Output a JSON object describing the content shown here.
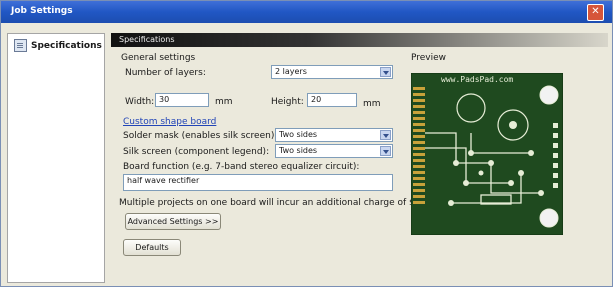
{
  "window": {
    "title": "Job Settings"
  },
  "nav": {
    "items": [
      {
        "label": "Specifications",
        "icon": "document-icon"
      }
    ]
  },
  "panel": {
    "header": "Specifications",
    "general_label": "General settings",
    "preview_label": "Preview",
    "layers_label": "Number of layers:",
    "layers_value": "2 layers",
    "width_label": "Width:",
    "width_value": "30",
    "width_unit": "mm",
    "height_label": "Height:",
    "height_value": "20",
    "height_unit": "mm",
    "custom_shape_link": "Custom shape board",
    "solder_mask_label": "Solder mask (enables silk screen):",
    "solder_mask_value": "Two sides",
    "silk_label": "Silk screen (component legend):",
    "silk_value": "Two sides",
    "function_label": "Board function (e.g. 7-band stereo equalizer circuit):",
    "function_value": "half wave rectifier",
    "note": "Multiple projects on one board will incur an additional charge of $20 each.",
    "advanced_button": "Advanced Settings >>",
    "defaults_button": "Defaults",
    "board_url": "www.PadsPad.com"
  },
  "colors": {
    "titlebar": "#2157c4",
    "pcb": "#1f4a1f",
    "trace": "#e6edd6",
    "pad": "#c8a23a"
  }
}
